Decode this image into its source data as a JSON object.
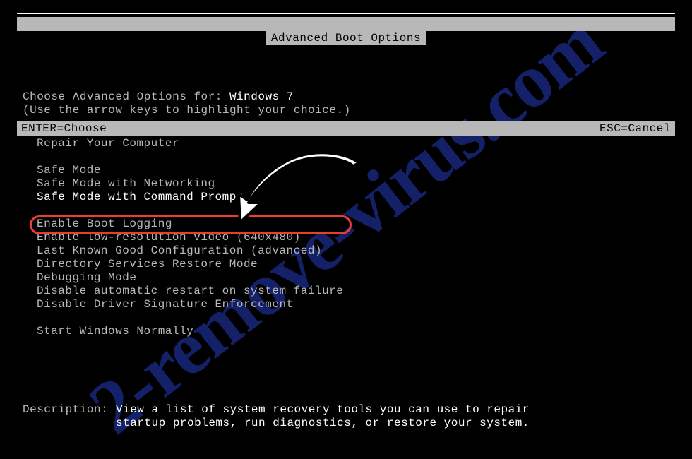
{
  "title": "Advanced Boot Options",
  "choose_prefix": "Choose Advanced Options for: ",
  "os_name": "Windows 7",
  "hint": "(Use the arrow keys to highlight your choice.)",
  "menu": {
    "group1": [
      "Repair Your Computer"
    ],
    "group2": [
      "Safe Mode",
      "Safe Mode with Networking",
      "Safe Mode with Command Prompt"
    ],
    "group3": [
      "Enable Boot Logging",
      "Enable low-resolution video (640x480)",
      "Last Known Good Configuration (advanced)",
      "Directory Services Restore Mode",
      "Debugging Mode",
      "Disable automatic restart on system failure",
      "Disable Driver Signature Enforcement"
    ],
    "group4": [
      "Start Windows Normally"
    ],
    "selected_label": "Safe Mode with Command Prompt"
  },
  "description": {
    "label": "Description:",
    "text": "View a list of system recovery tools you can use to repair\nstartup problems, run diagnostics, or restore your system."
  },
  "footer": {
    "enter": "ENTER=Choose",
    "esc": "ESC=Cancel"
  },
  "watermark": "2-remove-virus.com",
  "colors": {
    "highlight_border": "#e93d2f",
    "text_dim": "#b8b8b8",
    "text_bright": "#ffffff",
    "watermark": "#1b2b8a"
  }
}
